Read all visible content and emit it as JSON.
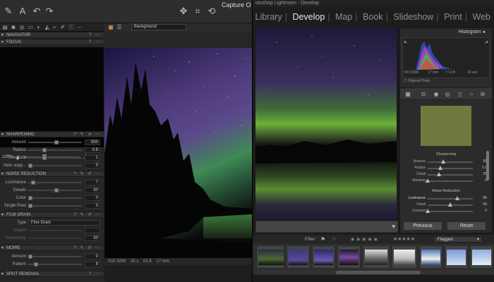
{
  "capture_one": {
    "title": "Capture O",
    "viewer_select": "Background",
    "panels": {
      "navigator": "NAVIGATOR",
      "focus": "FOCUS",
      "zoom_label": "100%",
      "sharpening": {
        "title": "SHARPENING",
        "rows": [
          {
            "label": "Amount",
            "value": "500"
          },
          {
            "label": "Radius",
            "value": "0.8"
          },
          {
            "label": "Threshold",
            "value": "1"
          },
          {
            "label": "Halo supp...",
            "value": "0"
          }
        ]
      },
      "noise": {
        "title": "NOISE REDUCTION",
        "rows": [
          {
            "label": "Luminance",
            "value": "7"
          },
          {
            "label": "Details",
            "value": "50"
          },
          {
            "label": "Color",
            "value": "0"
          },
          {
            "label": "Single Pixel",
            "value": "0"
          }
        ]
      },
      "grain": {
        "title": "FILM GRAIN",
        "type_label": "Type",
        "type_value": "Fine Grain",
        "rows": [
          {
            "label": "Impact",
            "value": ""
          },
          {
            "label": "Granularity",
            "value": "50"
          }
        ]
      },
      "moire": {
        "title": "MOIRE",
        "rows": [
          {
            "label": "Amount",
            "value": "0"
          },
          {
            "label": "Pattern",
            "value": "8"
          }
        ]
      },
      "spot": "SPOT REMOVAL"
    },
    "status": [
      "ISO 3200",
      "30 s",
      "f/2.8",
      "17 mm"
    ]
  },
  "lightroom": {
    "window_title": "otoshop Lightroom - Develop",
    "modules": [
      "Library",
      "Develop",
      "Map",
      "Book",
      "Slideshow",
      "Print",
      "Web"
    ],
    "active_module": "Develop",
    "histogram_title": "Histogram",
    "histo_info": [
      "ISO 3200",
      "17 mm",
      "f / 2.8",
      "30 sec"
    ],
    "original_photo": "Original Photo",
    "sharpening": {
      "title": "Sharpening",
      "rows": [
        {
          "label": "Amount",
          "value": "51",
          "pct": 0.34
        },
        {
          "label": "Radius",
          "value": "1.0",
          "pct": 0.28
        },
        {
          "label": "Detail",
          "value": "25",
          "pct": 0.25
        },
        {
          "label": "Masking",
          "value": "0",
          "pct": 0.0
        }
      ]
    },
    "noise": {
      "title": "Noise Reduction",
      "rows": [
        {
          "label": "Luminance",
          "value": "66",
          "pct": 0.66
        },
        {
          "label": "Detail",
          "value": "50",
          "pct": 0.5
        },
        {
          "label": "Contrast",
          "value": "0",
          "pct": 0.0
        }
      ]
    },
    "buttons": {
      "previous": "Previous",
      "reset": "Reset"
    },
    "filter_label": "Filter :",
    "flagged": "Flagged"
  }
}
